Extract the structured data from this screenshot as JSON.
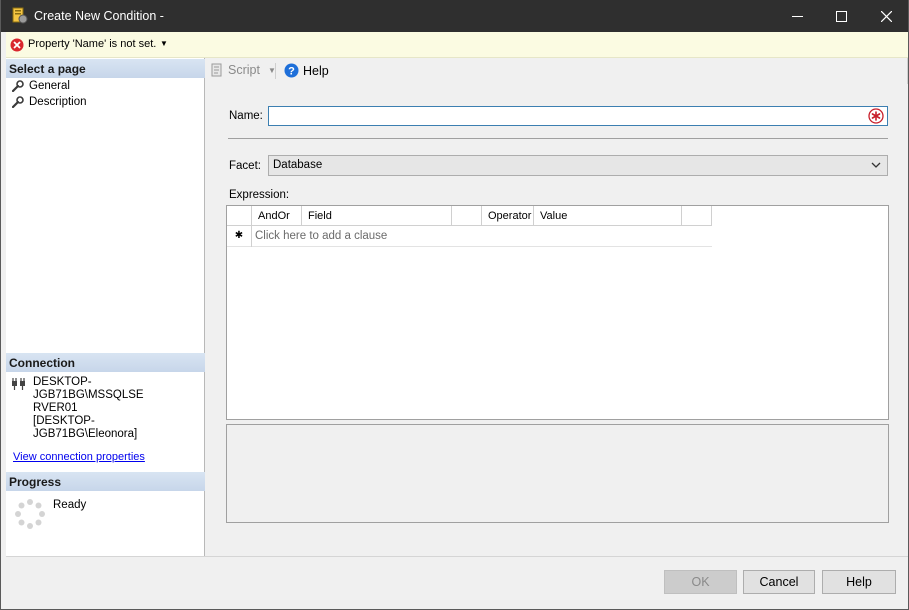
{
  "window": {
    "title": "Create New Condition -",
    "controls": {
      "minimize": "—",
      "maximize": "☐",
      "close": "✕"
    }
  },
  "banner": {
    "message": "Property 'Name' is not set.",
    "dropdown": "▼",
    "icon": "error-icon",
    "icon_color": "#d9262e"
  },
  "left": {
    "select_page_header": "Select a page",
    "pages": [
      {
        "label": "General",
        "icon": "wrench-icon"
      },
      {
        "label": "Description",
        "icon": "wrench-icon"
      }
    ],
    "connection_header": "Connection",
    "connection": {
      "line1": "DESKTOP-JGB71BG\\MSSQLSE",
      "line2": "RVER01",
      "line3": "[DESKTOP-JGB71BG\\Eleonora]",
      "icon": "plug-icon"
    },
    "connection_link": "View connection properties",
    "progress_header": "Progress",
    "progress_status": "Ready",
    "progress_icon": "spinner-icon"
  },
  "toolbar": {
    "script_label": "Script",
    "script_caret": "▼",
    "help_label": "Help",
    "help_icon_color": "#1e6fd9"
  },
  "form": {
    "name_label": "Name:",
    "name_value": "",
    "facet_label": "Facet:",
    "facet_value": "Database",
    "expression_label": "Expression:",
    "grid": {
      "columns": [
        "AndOr",
        "Field",
        "Operator",
        "Value"
      ],
      "new_row_marker": "✱",
      "add_clause_hint": "Click here to add a clause"
    }
  },
  "footer": {
    "ok": "OK",
    "cancel": "Cancel",
    "help": "Help"
  }
}
